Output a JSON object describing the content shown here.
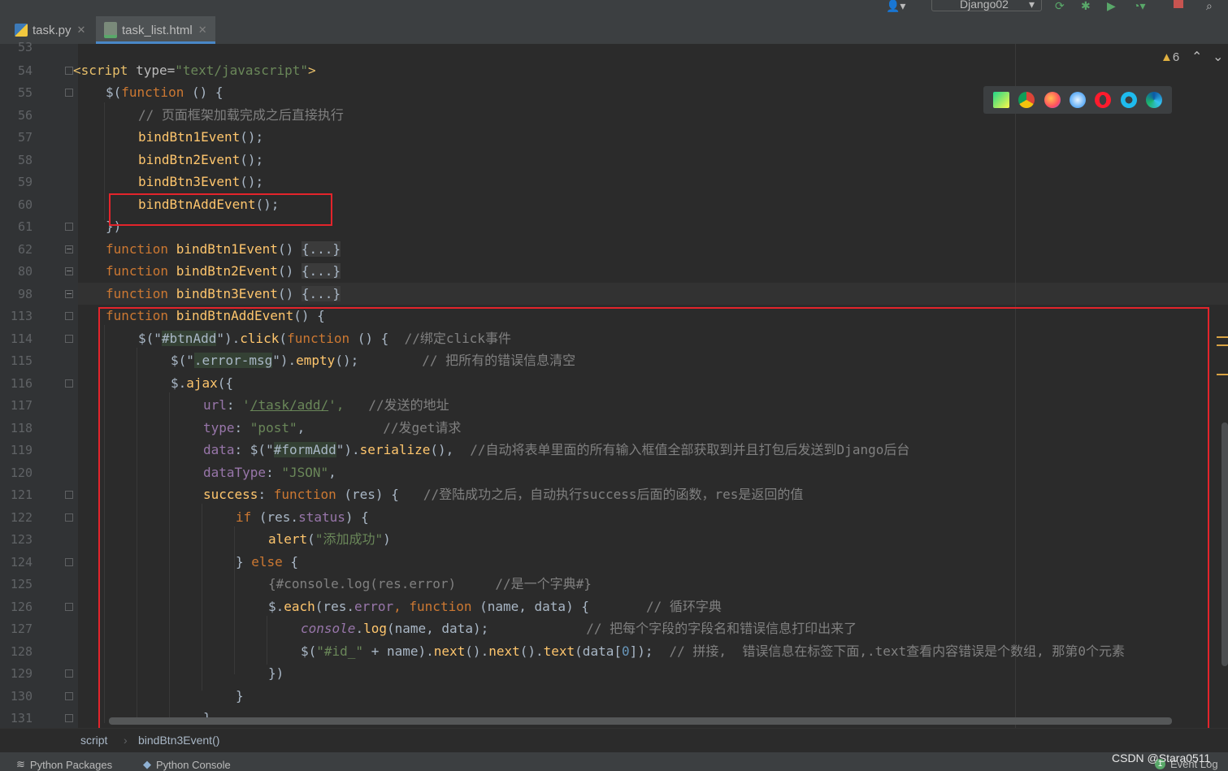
{
  "toolbar": {
    "run_config": "Django02",
    "icons": [
      "user-icon",
      "run-icon",
      "debug-icon",
      "coverage-icon",
      "profile-icon",
      "stop-icon",
      "search-icon"
    ]
  },
  "tabs": [
    {
      "label": "task.py",
      "icon": "python-file-icon",
      "active": false
    },
    {
      "label": "task_list.html",
      "icon": "html-file-icon",
      "active": true
    }
  ],
  "editor": {
    "warnings_count": "6",
    "browsers": [
      "pycharm-icon",
      "chrome-icon",
      "firefox-icon",
      "safari-icon",
      "opera-icon",
      "ie-icon",
      "edge-icon"
    ],
    "line_numbers": [
      "53",
      "54",
      "55",
      "56",
      "57",
      "58",
      "59",
      "60",
      "61",
      "62",
      "80",
      "98",
      "113",
      "114",
      "115",
      "116",
      "117",
      "118",
      "119",
      "120",
      "121",
      "122",
      "123",
      "124",
      "125",
      "126",
      "127",
      "128",
      "129",
      "130",
      "131"
    ],
    "lines": {
      "l54_a": "<script ",
      "l54_b": "type=",
      "l54_c": "\"text/javascript\"",
      "l54_d": ">",
      "l55_a": "$(",
      "l55_b": "function",
      "l55_c": " () {",
      "l56": "// 页面框架加载完成之后直接执行",
      "l57": "bindBtn1Event",
      "l58": "bindBtn2Event",
      "l59": "bindBtn3Event",
      "l60": "bindBtnAddEvent",
      "call_suffix": "();",
      "l61": "})",
      "kw_function": "function",
      "l62_name": "bindBtn1Event",
      "l80_name": "bindBtn2Event",
      "l98_name": "bindBtn3Event",
      "folded": "{...}",
      "parens": "() ",
      "l113_name": "bindBtnAddEvent",
      "l113_tail": "() {",
      "l114_a": "$(\"",
      "l114_sel": "#btnAdd",
      "l114_b": "\").",
      "l114_click": "click",
      "l114_c": "(",
      "l114_fn": "function",
      "l114_d": " () {  ",
      "l114_cm": "//绑定click事件",
      "l115_a": "$(\"",
      "l115_sel": ".error-msg",
      "l115_b": "\").",
      "l115_empty": "empty",
      "l115_c": "();",
      "l115_cm": "// 把所有的错误信息清空",
      "l116_a": "$.",
      "l116_ajax": "ajax",
      "l116_b": "({",
      "l117_key": "url",
      "l117_q1": "'",
      "l117_url": "/task/add/",
      "l117_q2": "',",
      "l117_cm": "//发送的地址",
      "l118_key": "type",
      "l118_val": "\"post\"",
      "l118_cm": "//发get请求",
      "l119_key": "data",
      "l119_a": "$(\"",
      "l119_sel": "#formAdd",
      "l119_b": "\").",
      "l119_ser": "serialize",
      "l119_c": "(),",
      "l119_cm": "//自动将表单里面的所有输入框值全部获取到并且打包后发送到Django后台",
      "l120_key": "dataType",
      "l120_val": "\"JSON\"",
      "l121_key": "success",
      "l121_fn": "function",
      "l121_b": " (res) {",
      "l121_cm": "//登陆成功之后，自动执行success后面的函数，res是返回的值",
      "l122_if": "if",
      "l122_a": " (res.",
      "l122_status": "status",
      "l122_b": ") {",
      "l123_alert": "alert",
      "l123_str": "\"添加成功\"",
      "l124_a": "} ",
      "l124_else": "else",
      "l124_b": " {",
      "l125_cm": "{#console.log(res.error)     //是一个字典#}",
      "l126_a": "$.",
      "l126_each": "each",
      "l126_b": "(res.",
      "l126_error": "error",
      "l126_c": ", ",
      "l126_fn": "function",
      "l126_d": " (name, data) {",
      "l126_cm": "// 循环字典",
      "l127_console": "console",
      "l127_dot": ".",
      "l127_log": "log",
      "l127_a": "(name, data);",
      "l127_cm": "// 把每个字段的字段名和错误信息打印出来了",
      "l128_a": "$(",
      "l128_str": "\"#id_\"",
      "l128_b": " + name).",
      "l128_next1": "next",
      "l128_c": "().",
      "l128_next2": "next",
      "l128_d": "().",
      "l128_text": "text",
      "l128_e": "(data[",
      "l128_zero": "0",
      "l128_f": "]);",
      "l128_cm": "// 拼接,  错误信息在标签下面,.text查看内容错误是个数组, 那第0个元素",
      "l129": "})",
      "l130": "}",
      "l131": "}"
    }
  },
  "breadcrumb": {
    "item1": "script",
    "sep": "›",
    "item2": "bindBtn3Event()"
  },
  "bottom_bar": {
    "python_packages": "Python Packages",
    "python_console": "Python Console",
    "event_log": "Event Log",
    "event_badge": "1"
  },
  "watermark": "CSDN @Stara0511"
}
